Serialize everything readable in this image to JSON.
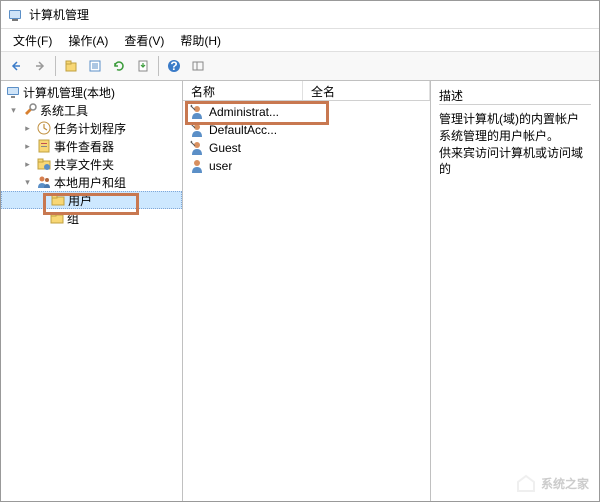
{
  "titlebar": {
    "title": "计算机管理"
  },
  "menubar": {
    "file": "文件(F)",
    "action": "操作(A)",
    "view": "查看(V)",
    "help": "帮助(H)"
  },
  "tree": {
    "root": "计算机管理(本地)",
    "system_tools": "系统工具",
    "task_scheduler": "任务计划程序",
    "event_viewer": "事件查看器",
    "shared_folders": "共享文件夹",
    "local_users_groups": "本地用户和组",
    "users": "用户",
    "groups": "组"
  },
  "list": {
    "col_name": "名称",
    "col_fullname": "全名",
    "items": [
      {
        "name": "Administrat..."
      },
      {
        "name": "DefaultAcc..."
      },
      {
        "name": "Guest"
      },
      {
        "name": "user"
      }
    ]
  },
  "desc": {
    "header": "描述",
    "line1": "管理计算机(域)的内置帐户",
    "line2": "系统管理的用户帐户。",
    "line3": "供来宾访问计算机或访问域的"
  },
  "watermark": "系统之家"
}
